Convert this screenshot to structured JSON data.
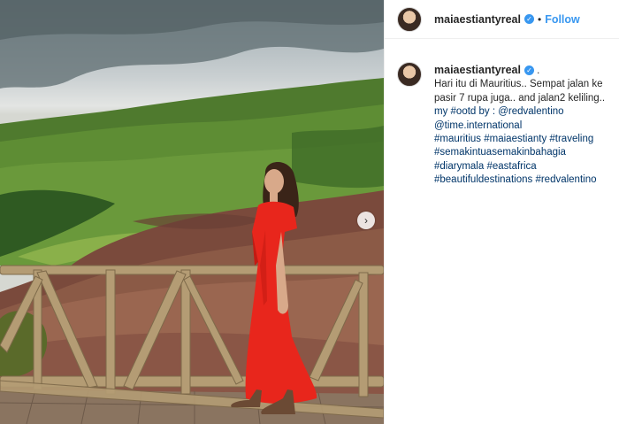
{
  "header": {
    "username": "maiaestiantyreal",
    "separator": "•",
    "follow_label": "Follow"
  },
  "photo": {
    "next_button_glyph": "›"
  },
  "caption": {
    "username": "maiaestiantyreal",
    "lines": [
      "Hari itu di Mauritius.. Sempat jalan ke",
      "pasir 7 rupa juga.. and jalan2 keliling..",
      "my #ootd by : @redvalentino",
      "@time.international",
      "#mauritius #maiaestianty #traveling",
      "#semakintuasemakinbahagia",
      "#diarymala #eastafrica",
      "#beautifuldestinations #redvalentino"
    ]
  },
  "colors": {
    "accent": "#3897f0",
    "dress": "#e8261c",
    "hashtag": "#003569"
  }
}
